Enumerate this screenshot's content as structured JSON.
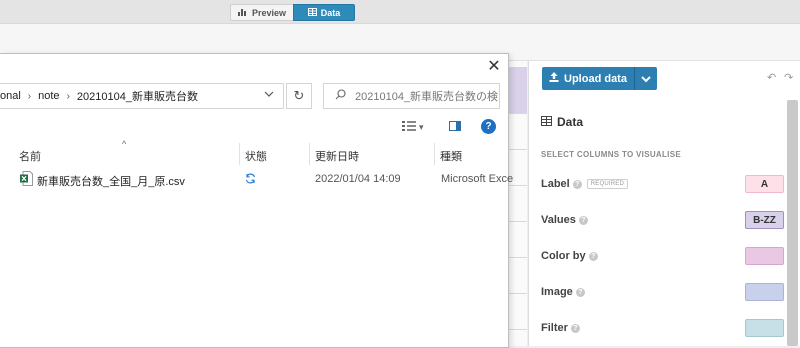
{
  "view_toggle": {
    "preview_label": "Preview",
    "data_label": "Data"
  },
  "dialog": {
    "breadcrumb": [
      "onal",
      "note",
      "20210104_新車販売台数"
    ],
    "search_placeholder": "20210104_新車販売台数の検...",
    "columns": [
      "名前",
      "状態",
      "更新日時",
      "種類"
    ],
    "files": [
      {
        "name": "新車販売台数_全国_月_原.csv",
        "modified": "2022/01/04 14:09",
        "type": "Microsoft Exce"
      }
    ]
  },
  "panel": {
    "upload_label": "Upload data",
    "data_heading": "Data",
    "select_heading": "SELECT COLUMNS TO VISUALISE",
    "required_badge": "REQUIRED",
    "fields": [
      {
        "label": "Label",
        "value": "A",
        "color": "#fde0e8",
        "border": "#f3b9c8"
      },
      {
        "label": "Values",
        "value": "B-ZZ",
        "color": "#d9d0ea",
        "border": "#9e90c4"
      },
      {
        "label": "Color by",
        "value": "",
        "color": "#e9c8e3",
        "border": "#d7a6cf"
      },
      {
        "label": "Image",
        "value": "",
        "color": "#c8d0ec",
        "border": "#a7b3dc"
      },
      {
        "label": "Filter",
        "value": "",
        "color": "#c7dfe6",
        "border": "#a6c8d3"
      }
    ]
  }
}
